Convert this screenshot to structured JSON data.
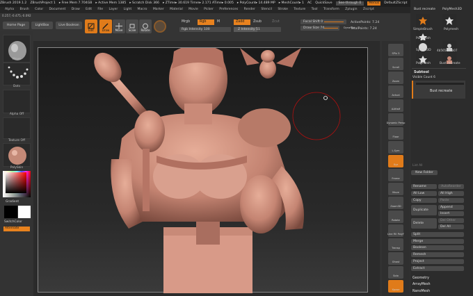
{
  "titlebar": {
    "items": [
      "ZBrush 2019.1.2",
      "ZBrushProject 1",
      "▸ Free Mem 7.704GB",
      "▸ Active Mem 1385",
      "▸ Scratch Disk 366",
      "▸ ZTime▸ 30.619 Timer▸ 2.171 ATime▸ 0.005",
      "▸ PolyCount▸ 14.489 MP",
      "▸ MeshCount▸ 1",
      "AC",
      "QuickSave",
      "See-through 0",
      "Menus",
      "DefaultZScript"
    ]
  },
  "menubar": {
    "items": [
      "Alpha",
      "Brush",
      "Color",
      "Document",
      "Draw",
      "Edit",
      "File",
      "Layer",
      "Light",
      "Macro",
      "Marker",
      "Material",
      "Movie",
      "Picker",
      "Preferences",
      "Render",
      "Stencil",
      "Stroke",
      "Texture",
      "Tool",
      "Transform",
      "Zplugin",
      "Zscript"
    ]
  },
  "coords": "0.257,-0.475,-0.092",
  "toolbar": {
    "home": "Home Page",
    "lightbox": "LightBox",
    "live_boolean": "Live Boolean",
    "edit": "Edit",
    "draw": "Draw",
    "move": "Move",
    "scale": "Scale",
    "rotate": "Rotate",
    "mrgb": "Mrgb",
    "rgb": "Rgb",
    "m": "M",
    "zadd": "Zadd",
    "zsub": "Zsub",
    "zcut": "Zcut",
    "rgb_intensity": "Rgb Intensity 100",
    "z_intensity": "Z Intensity 51",
    "focal_shift": "Focal Shift 0",
    "draw_size": "Draw Size 74",
    "dynamic": "Dynamic",
    "active_points": "ActivePoints: 7.24",
    "total_points": "TotalPoints: 7.24"
  },
  "leftpanel": {
    "move": "Move",
    "dots": "Dots",
    "alpha": "Alpha Off",
    "texture": "Texture Off",
    "material": "PolySkin",
    "gradient": "Gradient",
    "switch": "SwitchColor",
    "alternate": "Alternate"
  },
  "rightcol": {
    "items": [
      "SPix 3",
      "Scroll",
      "Zoom",
      "Actual",
      "AAHalf",
      "Dynamic Persp",
      "Floor",
      "L.Sym",
      "Xyz",
      "Frame",
      "Move",
      "Zoom3D",
      "Rotate",
      "Line Fill PolyF",
      "Transp",
      "Ghost",
      "Solo",
      "Xpose"
    ]
  },
  "tools": {
    "header": "Bust recreate",
    "header2": "PolyMesh3D",
    "simple_brush": "SimpleBrush",
    "polymesh": "Polymesh",
    "polymesh2": "Polymesh",
    "sphere3d": "Sphere3D",
    "bust_cut": "4b565dff4b07",
    "bust_recreate": "Bust recreate",
    "subtool_title": "Subtool",
    "visible_count": "Visible Count 6",
    "subtool_item": "Bust recreate",
    "list_all": "List All",
    "new_folder": "New Folder",
    "rename": "Rename",
    "autoreorder": "AutoReorder",
    "all_low": "All Low",
    "all_high": "All High",
    "copy": "Copy",
    "paste": "Paste",
    "duplicate": "Duplicate",
    "append": "Append",
    "insert": "Insert",
    "delete": "Delete",
    "del_other": "Del Other",
    "del_all": "Del All",
    "split": "Split",
    "merge": "Merge",
    "boolean": "Boolean",
    "remesh": "Remesh",
    "project": "Project",
    "extract": "Extract",
    "geometry": "Geometry",
    "arraymesh": "ArrayMesh",
    "nanomesh": "NanoMesh"
  },
  "colors": {
    "accent": "#e07b1a",
    "skin": "#c98a78",
    "bg": "#323232"
  }
}
